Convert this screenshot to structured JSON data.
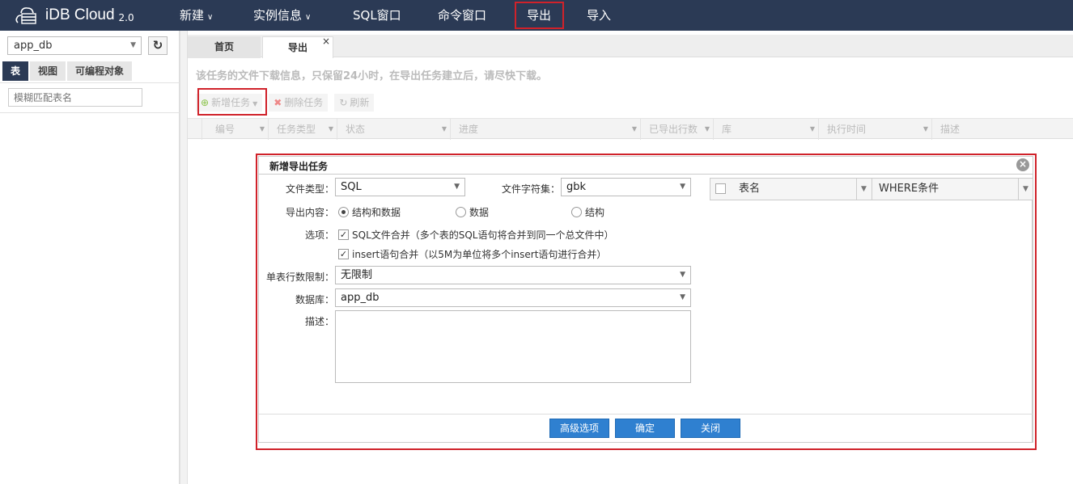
{
  "app": {
    "name": "iDB Cloud",
    "version": "2.0"
  },
  "nav": [
    {
      "label": "新建",
      "dropdown": true
    },
    {
      "label": "实例信息",
      "dropdown": true
    },
    {
      "label": "SQL窗口",
      "dropdown": false
    },
    {
      "label": "命令窗口",
      "dropdown": false
    },
    {
      "label": "导出",
      "dropdown": false,
      "highlighted": true
    },
    {
      "label": "导入",
      "dropdown": false
    }
  ],
  "sidebar": {
    "db_select_value": "app_db",
    "tabs": [
      {
        "label": "表",
        "active": true
      },
      {
        "label": "视图",
        "active": false
      },
      {
        "label": "可编程对象",
        "active": false
      }
    ],
    "filter_placeholder": "模糊匹配表名"
  },
  "tabs": [
    {
      "label": "首页",
      "active": false
    },
    {
      "label": "导出",
      "active": true,
      "close": "×"
    }
  ],
  "info_text": "该任务的文件下载信息，只保留24小时，在导出任务建立后，请尽快下载。",
  "toolbar": {
    "new_task": "新增任务",
    "delete_task": "删除任务",
    "refresh": "刷新"
  },
  "grid_columns": [
    "编号",
    "任务类型",
    "状态",
    "进度",
    "已导出行数",
    "库",
    "执行时间",
    "描述"
  ],
  "dialog": {
    "title": "新增导出任务",
    "close_icon": "×",
    "file_type_label": "文件类型：",
    "file_type_value": "SQL",
    "charset_label": "文件字符集：",
    "charset_value": "gbk",
    "content_label": "导出内容：",
    "content_options": [
      {
        "label": "结构和数据",
        "selected": true
      },
      {
        "label": "数据",
        "selected": false
      },
      {
        "label": "结构",
        "selected": false
      }
    ],
    "options_label": "选项：",
    "option_sql_merge": "SQL文件合并（多个表的SQL语句将合并到同一个总文件中）",
    "option_insert_merge": "insert语句合并（以5M为单位将多个insert语句进行合并）",
    "row_limit_label": "单表行数限制：",
    "row_limit_value": "无限制",
    "database_label": "数据库：",
    "database_value": "app_db",
    "desc_label": "描述：",
    "table_col_name": "表名",
    "table_col_where": "WHERE条件",
    "buttons": {
      "advanced": "高级选项",
      "ok": "确定",
      "close": "关闭"
    }
  },
  "colors": {
    "topbar": "#2b3a55",
    "highlight": "#d0222a",
    "button": "#2f80d0"
  }
}
